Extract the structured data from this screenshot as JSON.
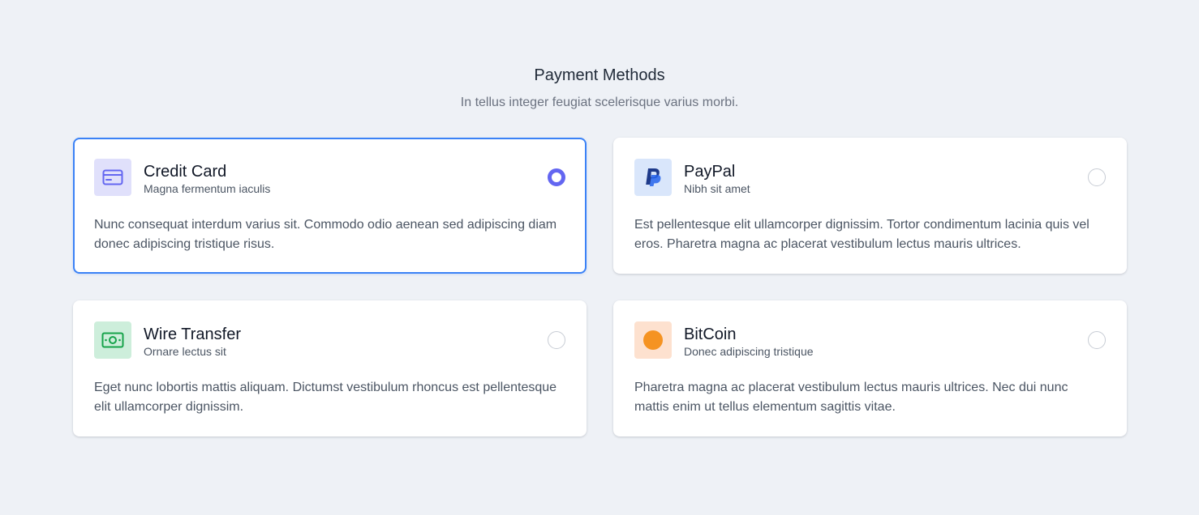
{
  "header": {
    "title": "Payment Methods",
    "subtitle": "In tellus integer feugiat scelerisque varius morbi."
  },
  "colors": {
    "background": "#eef1f6",
    "selected_border": "#3b82f6",
    "radio_checked": "#6366f1"
  },
  "methods": [
    {
      "title": "Credit Card",
      "subtitle": "Magna fermentum iaculis",
      "description": "Nunc consequat interdum varius sit. Commodo odio aenean sed adipiscing diam donec adipiscing tristique risus.",
      "icon": "credit-card-icon",
      "icon_bg": "#e0e0fb",
      "icon_color": "#6366f1",
      "selected": true
    },
    {
      "title": "PayPal",
      "subtitle": "Nibh sit amet",
      "description": "Est pellentesque elit ullamcorper dignissim. Tortor condimentum lacinia quis vel eros. Pharetra magna ac placerat vestibulum lectus mauris ultrices.",
      "icon": "paypal-icon",
      "icon_bg": "#d9e6fb",
      "icon_color": "#1e3a8a",
      "selected": false
    },
    {
      "title": "Wire Transfer",
      "subtitle": "Ornare lectus sit",
      "description": "Eget nunc lobortis mattis aliquam. Dictumst vestibulum rhoncus est pellentesque elit ullamcorper dignissim.",
      "icon": "banknote-icon",
      "icon_bg": "#cdeedb",
      "icon_color": "#16a34a",
      "selected": false
    },
    {
      "title": "BitCoin",
      "subtitle": "Donec adipiscing tristique",
      "description": "Pharetra magna ac placerat vestibulum lectus mauris ultrices. Nec dui nunc mattis enim ut tellus elementum sagittis vitae.",
      "icon": "bitcoin-icon",
      "icon_bg": "#fde1cf",
      "icon_color": "#f59322",
      "selected": false
    }
  ]
}
